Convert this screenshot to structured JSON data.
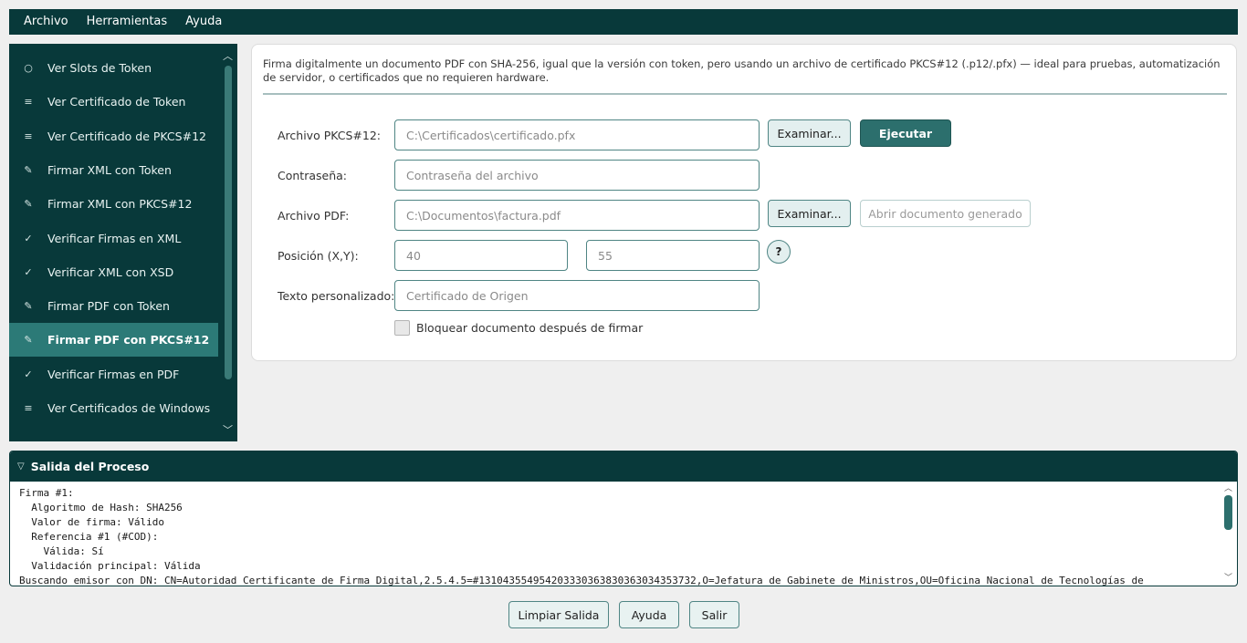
{
  "menu": [
    "Archivo",
    "Herramientas",
    "Ayuda"
  ],
  "sidebar": {
    "items": [
      {
        "icon": "○",
        "label": "Ver Slots de Token",
        "active": false
      },
      {
        "icon": "≡",
        "label": "Ver Certificado de Token",
        "active": false
      },
      {
        "icon": "≡",
        "label": "Ver Certificado de PKCS#12",
        "active": false
      },
      {
        "icon": "✎",
        "label": "Firmar XML con Token",
        "active": false
      },
      {
        "icon": "✎",
        "label": "Firmar XML con PKCS#12",
        "active": false
      },
      {
        "icon": "✓",
        "label": "Verificar Firmas en XML",
        "active": false
      },
      {
        "icon": "✓",
        "label": "Verificar XML con XSD",
        "active": false
      },
      {
        "icon": "✎",
        "label": "Firmar PDF con Token",
        "active": false
      },
      {
        "icon": "✎",
        "label": "Firmar PDF con PKCS#12",
        "active": true
      },
      {
        "icon": "✓",
        "label": "Verificar Firmas en PDF",
        "active": false
      },
      {
        "icon": "≡",
        "label": "Ver Certificados de Windows",
        "active": false
      }
    ]
  },
  "form": {
    "description": "Firma digitalmente un documento PDF con SHA-256, igual que la versión con token, pero usando un archivo de certificado PKCS#12 (.p12/.pfx) — ideal para pruebas, automatización de servidor, o certificados que no requieren hardware.",
    "pkcs12_label": "Archivo PKCS#12:",
    "pkcs12_placeholder": "C:\\Certificados\\certificado.pfx",
    "browse_label": "Examinar...",
    "execute_label": "Ejecutar",
    "password_label": "Contraseña:",
    "password_placeholder": "Contraseña del archivo",
    "pdf_label": "Archivo PDF:",
    "pdf_placeholder": "C:\\Documentos\\factura.pdf",
    "open_generated_label": "Abrir documento generado",
    "position_label": "Posición (X,Y):",
    "x_placeholder": "40",
    "y_placeholder": "55",
    "help_label": "?",
    "custom_text_label": "Texto personalizado:",
    "custom_text_placeholder": "Certificado de Origen",
    "lock_label": "Bloquear documento después de firmar",
    "lock_checked": false
  },
  "output": {
    "title": "Salida del Proceso",
    "lines": [
      "Firma #1:",
      "  Algoritmo de Hash: SHA256",
      "  Valor de firma: Válido",
      "  Referencia #1 (#COD):",
      "    Válida: Sí",
      "  Validación principal: Válida",
      "Buscando emisor con DN: CN=Autoridad Certificante de Firma Digital,2.5.4.5=#131043554954203330363830363034353732,O=Jefatura de Gabinete de Ministros,OU=Oficina Nacional de Tecnologías de"
    ]
  },
  "footer": {
    "clear_label": "Limpiar Salida",
    "help_label": "Ayuda",
    "exit_label": "Salir"
  },
  "colors": {
    "primary_dark": "#08393a",
    "accent": "#2c7a77",
    "button_dark": "#2c6f6d"
  }
}
